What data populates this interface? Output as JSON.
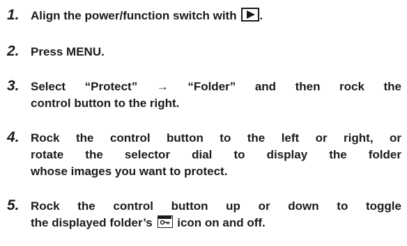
{
  "steps": [
    {
      "number": "1.",
      "lines": [
        "Align the power/function switch with ",
        "."
      ],
      "icon": "playback-mode-icon"
    },
    {
      "number": "2.",
      "lines": [
        "Press MENU."
      ]
    },
    {
      "number": "3.",
      "lines": [
        "Select “Protect” → “Folder” and then rock the",
        "control button to the right."
      ]
    },
    {
      "number": "4.",
      "lines": [
        "Rock the control button to the left or right, or",
        "rotate the selector dial to display the folder",
        "whose images you want to protect."
      ]
    },
    {
      "number": "5.",
      "lines": [
        "Rock the control button up or down to toggle",
        "the displayed folder’s ",
        " icon on and off."
      ],
      "icon": "protect-key-icon"
    }
  ]
}
